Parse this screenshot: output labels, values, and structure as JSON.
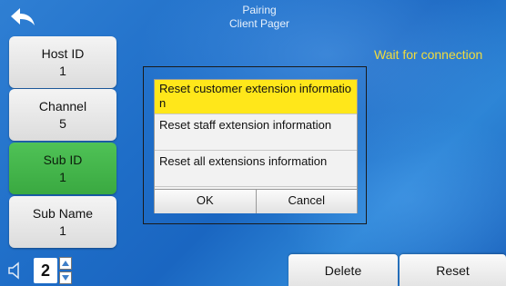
{
  "header": {
    "title": "Pairing",
    "subtitle": "Client Pager"
  },
  "status_text": "Wait for connection",
  "side": [
    {
      "label": "Host ID",
      "value": "1"
    },
    {
      "label": "Channel",
      "value": "5"
    },
    {
      "label": "Sub ID",
      "value": "1"
    },
    {
      "label": "Sub Name",
      "value": "1"
    }
  ],
  "dialog": {
    "options": [
      "Reset customer extension information",
      "Reset staff extension information",
      "Reset all extensions information"
    ],
    "ok_label": "OK",
    "cancel_label": "Cancel"
  },
  "volume": {
    "value": "2"
  },
  "bottom": {
    "delete_label": "Delete",
    "reset_label": "Reset"
  },
  "colors": {
    "status": "#f1dc3d",
    "selected": "#ffe71a",
    "active": "#4fc256"
  }
}
